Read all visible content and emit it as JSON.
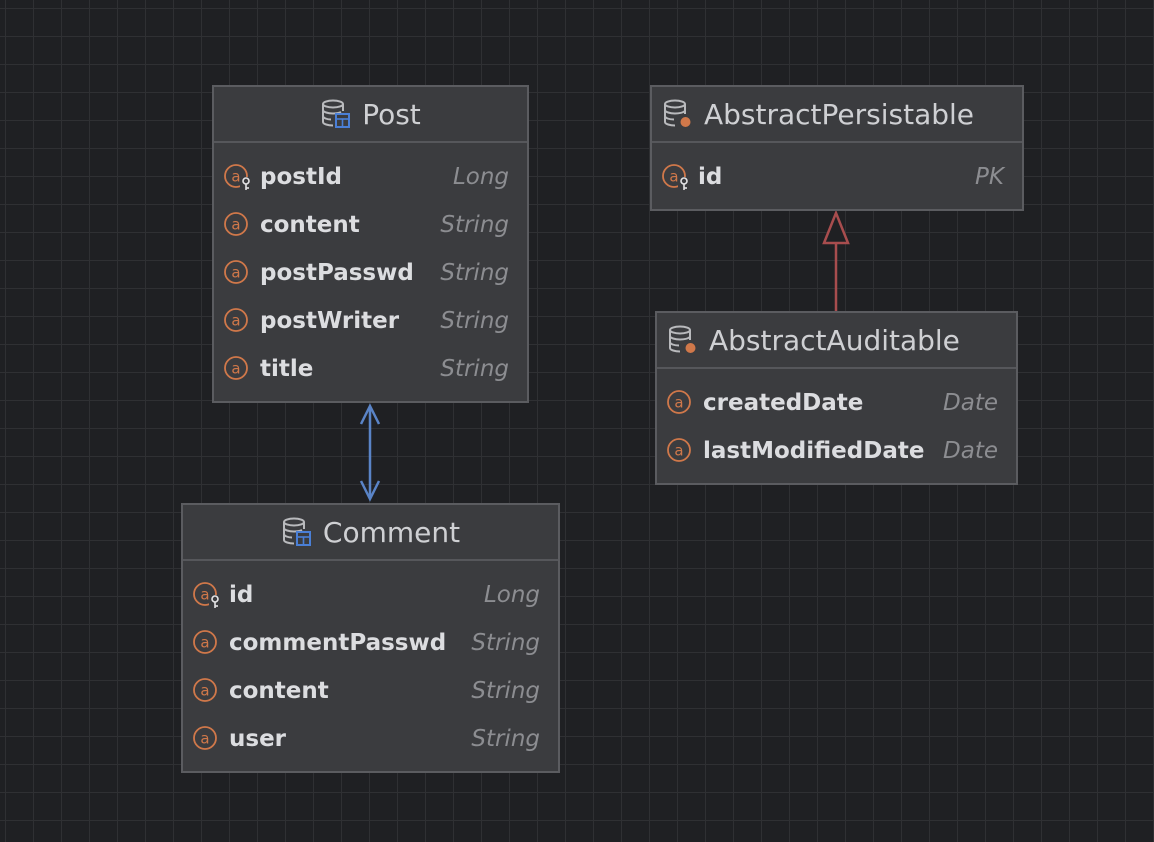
{
  "colors": {
    "background": "#1f2023",
    "entity_fill": "#3b3c3f",
    "field_icon": "#d0784a",
    "table_badge": "#4a7fd6",
    "association_edge": "#5a84c7",
    "inheritance_edge": "#a84d4e"
  },
  "entities": {
    "post": {
      "title": "Post",
      "icon": "database-table-icon",
      "fields": [
        {
          "name": "postId",
          "type": "Long",
          "icon": "primary-key-field-icon"
        },
        {
          "name": "content",
          "type": "String",
          "icon": "field-icon"
        },
        {
          "name": "postPasswd",
          "type": "String",
          "icon": "field-icon"
        },
        {
          "name": "postWriter",
          "type": "String",
          "icon": "field-icon"
        },
        {
          "name": "title",
          "type": "String",
          "icon": "field-icon"
        }
      ]
    },
    "comment": {
      "title": "Comment",
      "icon": "database-table-icon",
      "fields": [
        {
          "name": "id",
          "type": "Long",
          "icon": "primary-key-field-icon"
        },
        {
          "name": "commentPasswd",
          "type": "String",
          "icon": "field-icon"
        },
        {
          "name": "content",
          "type": "String",
          "icon": "field-icon"
        },
        {
          "name": "user",
          "type": "String",
          "icon": "field-icon"
        }
      ]
    },
    "abstract_persistable": {
      "title": "AbstractPersistable",
      "icon": "database-mapped-superclass-icon",
      "fields": [
        {
          "name": "id",
          "type": "PK",
          "icon": "primary-key-field-icon"
        }
      ]
    },
    "abstract_auditable": {
      "title": "AbstractAuditable",
      "icon": "database-mapped-superclass-icon",
      "fields": [
        {
          "name": "createdDate",
          "type": "Date",
          "icon": "field-icon"
        },
        {
          "name": "lastModifiedDate",
          "type": "Date",
          "icon": "field-icon"
        }
      ]
    }
  },
  "relations": [
    {
      "from": "Post",
      "to": "Comment",
      "kind": "bidirectional-association"
    },
    {
      "from": "AbstractAuditable",
      "to": "AbstractPersistable",
      "kind": "inheritance"
    }
  ]
}
